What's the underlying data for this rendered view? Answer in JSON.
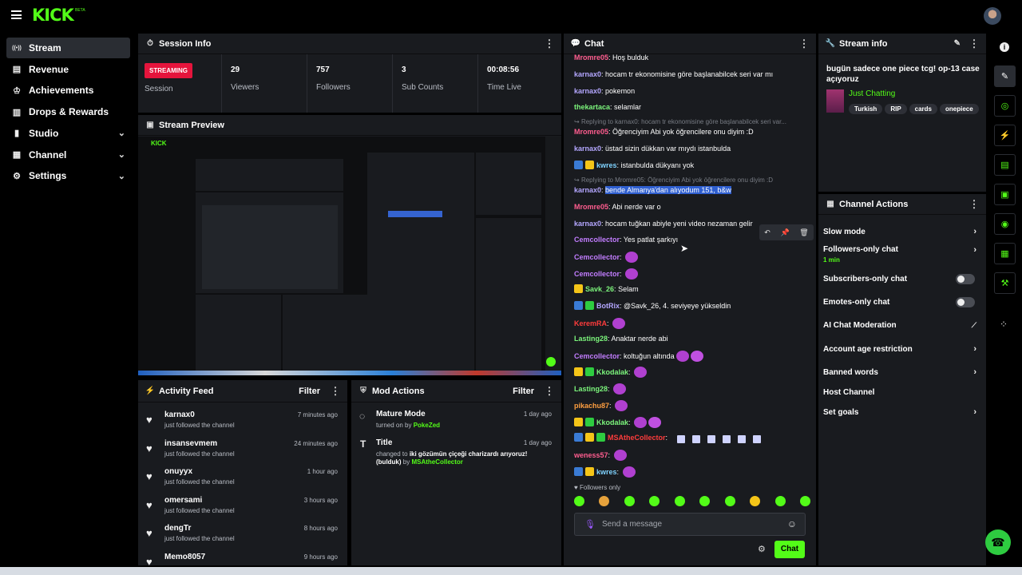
{
  "brand": {
    "logo": "KICK",
    "beta": "BETA",
    "accent": "#53fc18"
  },
  "nav": {
    "items": [
      {
        "label": "Stream",
        "icon": "broadcast-icon",
        "active": true
      },
      {
        "label": "Revenue",
        "icon": "cash-icon"
      },
      {
        "label": "Achievements",
        "icon": "trophy-icon"
      },
      {
        "label": "Drops & Rewards",
        "icon": "gift-icon"
      },
      {
        "label": "Studio",
        "icon": "studio-icon",
        "chevron": true
      },
      {
        "label": "Channel",
        "icon": "channel-icon",
        "chevron": true
      },
      {
        "label": "Settings",
        "icon": "gear-icon",
        "chevron": true
      }
    ]
  },
  "session": {
    "title": "Session Info",
    "badge": "STREAMING",
    "badge_label": "Session",
    "stats": [
      {
        "value": "29",
        "label": "Viewers"
      },
      {
        "value": "757",
        "label": "Followers"
      },
      {
        "value": "3",
        "label": "Sub Counts"
      },
      {
        "value": "00:08:56",
        "label": "Time Live"
      }
    ]
  },
  "preview": {
    "title": "Stream Preview"
  },
  "activity": {
    "title": "Activity Feed",
    "filter": "Filter",
    "items": [
      {
        "name": "karnax0",
        "sub": "just followed the channel",
        "time": "7 minutes ago"
      },
      {
        "name": "insansevmem",
        "sub": "just followed the channel",
        "time": "24 minutes ago"
      },
      {
        "name": "onuyyx",
        "sub": "just followed the channel",
        "time": "1 hour ago"
      },
      {
        "name": "omersami",
        "sub": "just followed the channel",
        "time": "3 hours ago"
      },
      {
        "name": "dengTr",
        "sub": "just followed the channel",
        "time": "8 hours ago"
      },
      {
        "name": "Memo8057",
        "sub": "",
        "time": "9 hours ago"
      }
    ]
  },
  "mod": {
    "title": "Mod Actions",
    "filter": "Filter",
    "items": [
      {
        "title": "Mature Mode",
        "pre": "turned on by ",
        "by": "PokeZed",
        "time": "1 day ago"
      },
      {
        "title": "Title",
        "pre": "changed to ",
        "text": "iki gözümün çiçeği charizardı arıyoruz! (bulduk)",
        "mid": " by ",
        "by": "MSAtheCollector",
        "time": "1 day ago"
      }
    ]
  },
  "chat": {
    "title": "Chat",
    "followers_only": "Followers only",
    "placeholder": "Send a message",
    "send": "Chat",
    "lines": [
      {
        "user": "Mromre05",
        "color": "#ff5d8f",
        "text": "Hoş bulduk"
      },
      {
        "user": "karnax0",
        "color": "#b4a7ff",
        "text": "hocam tr ekonomisine göre başlanabilcek seri var mı"
      },
      {
        "user": "karnax0",
        "color": "#b4a7ff",
        "text": "pokemon"
      },
      {
        "user": "thekartaca",
        "color": "#7cf57c",
        "text": "selamlar"
      },
      {
        "reply": "Replying to karnax0: hocam tr ekonomisine göre başlanabilcek seri var..."
      },
      {
        "user": "Mromre05",
        "color": "#ff5d8f",
        "text": "Öğrenciyim Abi yok öğrencilere onu diyim :D"
      },
      {
        "user": "karnax0",
        "color": "#b4a7ff",
        "text": "üstad sizin dükkan var mıydı istanbulda"
      },
      {
        "user": "kwres",
        "color": "#7fd3ff",
        "text": "istanbulda dükyanı yok"
      },
      {
        "reply": "Replying to Mromre05: Öğrenciyim Abi yok öğrencilere onu diyim :D"
      },
      {
        "user": "karnax0",
        "color": "#b4a7ff",
        "text": "bende Almanya'dan alıyodum 151, b&w"
      },
      {
        "user": "Mromre05",
        "color": "#ff5d8f",
        "text": "Abi nerde var o"
      },
      {
        "user": "karnax0",
        "color": "#b4a7ff",
        "text": "hocam tuğkan abiyle yeni video nezaman gelir"
      },
      {
        "user": "Cemcollector",
        "color": "#c27dff",
        "text": "Yes patlat şarkıyı"
      },
      {
        "user": "Cemcollector",
        "color": "#c27dff",
        "text": ""
      },
      {
        "user": "Cemcollector",
        "color": "#c27dff",
        "text": ""
      },
      {
        "user": "Savk_26",
        "color": "#7cf57c",
        "text": "Selam"
      },
      {
        "user": "BotRix",
        "color": "#b4a7ff",
        "text": "@Savk_26, 4. seviyeye yükseldin"
      },
      {
        "user": "KeremRA",
        "color": "#ff3c3c",
        "text": ""
      },
      {
        "user": "Lasting28",
        "color": "#7cf57c",
        "text": "Anaktar nerde abi"
      },
      {
        "user": "Cemcollector",
        "color": "#c27dff",
        "text": "koltuğun altında"
      },
      {
        "user": "Kkodalak",
        "color": "#7cf57c",
        "text": ""
      },
      {
        "user": "Lasting28",
        "color": "#7cf57c",
        "text": ""
      },
      {
        "user": "pikachu87",
        "color": "#ff9f40",
        "text": ""
      },
      {
        "user": "Kkodalak",
        "color": "#7cf57c",
        "text": ""
      },
      {
        "user": "MSAtheCollector",
        "color": "#ff3c3c",
        "text": ""
      },
      {
        "user": "weness57",
        "color": "#ff5d8f",
        "text": ""
      },
      {
        "user": "kwres",
        "color": "#7fd3ff",
        "text": ""
      }
    ]
  },
  "stream_info": {
    "title": "Stream info",
    "stream_title": "bugün sadece one piece tcg! op-13 case açıyoruz",
    "category": "Just Chatting",
    "tags": [
      "Turkish",
      "RIP",
      "cards",
      "onepiece"
    ]
  },
  "channel_actions": {
    "title": "Channel Actions",
    "items": [
      {
        "label": "Slow mode",
        "type": "chevron"
      },
      {
        "label": "Followers-only chat",
        "sub": "1 min",
        "type": "chevron"
      },
      {
        "label": "Subscribers-only chat",
        "type": "toggle"
      },
      {
        "label": "Emotes-only chat",
        "type": "toggle"
      },
      {
        "label": "AI Chat Moderation",
        "type": "chart"
      },
      {
        "label": "Account age restriction",
        "type": "chevron"
      },
      {
        "label": "Banned words",
        "type": "chevron"
      },
      {
        "label": "Host Channel",
        "type": "none"
      },
      {
        "label": "Set goals",
        "type": "chevron"
      }
    ]
  }
}
